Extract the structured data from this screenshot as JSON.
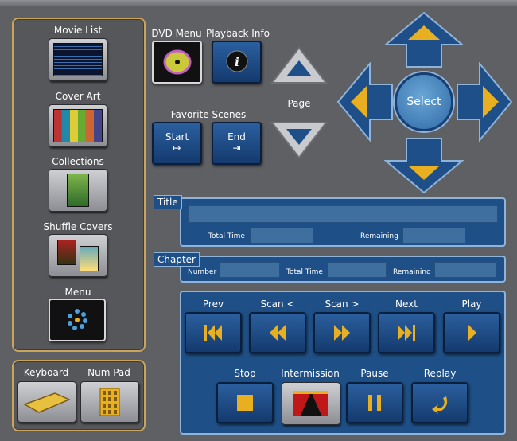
{
  "left_panel": {
    "items": [
      {
        "label": "Movie List"
      },
      {
        "label": "Cover Art"
      },
      {
        "label": "Collections"
      },
      {
        "label": "Shuffle Covers"
      },
      {
        "label": "Menu"
      }
    ]
  },
  "input_panel": {
    "keyboard_label": "Keyboard",
    "numpad_label": "Num Pad"
  },
  "top": {
    "dvd_menu_label": "DVD Menu",
    "playback_info_label": "Playback Info",
    "favorite_scenes_label": "Favorite Scenes",
    "start_label": "Start",
    "end_label": "End",
    "page_label": "Page"
  },
  "dpad": {
    "select_label": "Select"
  },
  "title_panel": {
    "tag": "Title",
    "total_time_label": "Total Time",
    "remaining_label": "Remaining"
  },
  "chapter_panel": {
    "tag": "Chapter",
    "number_label": "Number",
    "total_time_label": "Total Time",
    "remaining_label": "Remaining"
  },
  "transport": {
    "prev": "Prev",
    "scan_back": "Scan <",
    "scan_fwd": "Scan >",
    "next": "Next",
    "play": "Play",
    "stop": "Stop",
    "intermission": "Intermission",
    "pause": "Pause",
    "replay": "Replay"
  },
  "colors": {
    "accent_gold": "#e8b020",
    "panel_blue": "#1e4f86",
    "border_gold": "#c9a45a"
  }
}
